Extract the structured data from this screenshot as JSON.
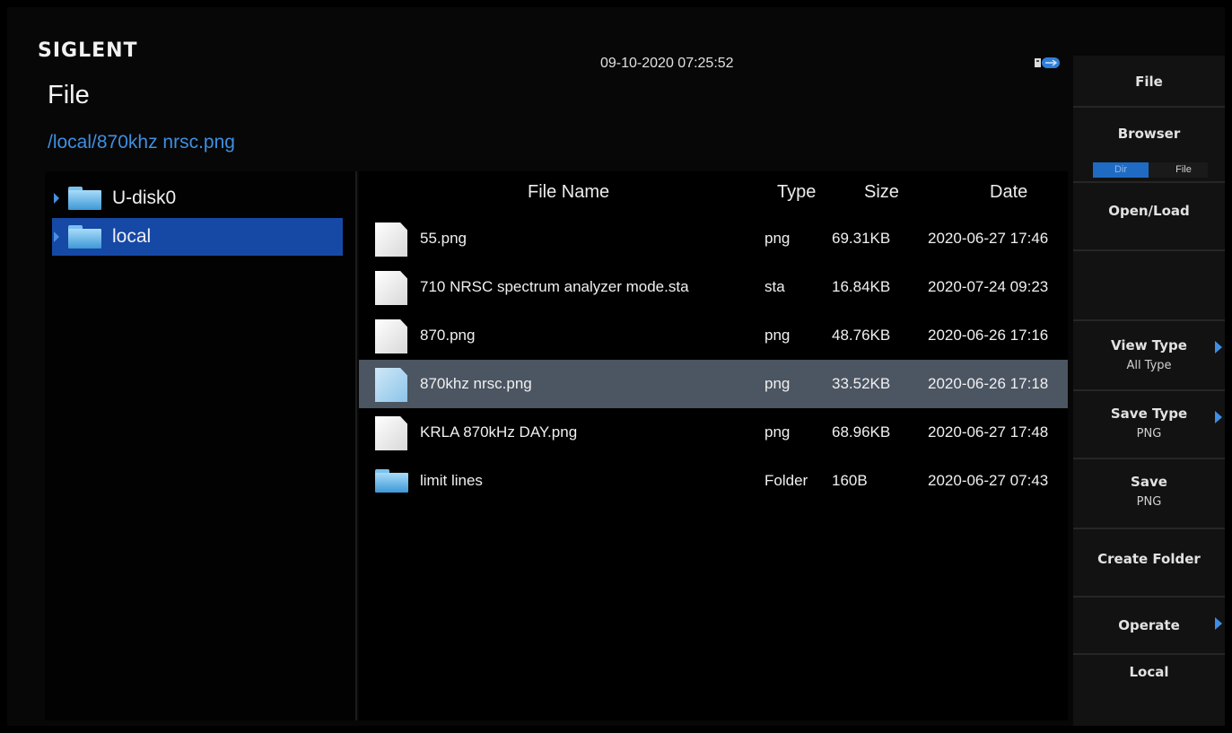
{
  "header": {
    "brand": "SIGLENT",
    "title": "File",
    "datetime": "09-10-2020 07:25:52",
    "usb_icon": "usb-storage-icon",
    "path": "/local/870khz nrsc.png"
  },
  "tree": {
    "items": [
      {
        "label": "U-disk0",
        "icon": "folder-icon",
        "selected": false
      },
      {
        "label": "local",
        "icon": "folder-icon",
        "selected": true
      }
    ]
  },
  "list": {
    "columns": {
      "name": "File Name",
      "type": "Type",
      "size": "Size",
      "date": "Date"
    },
    "rows": [
      {
        "name": "55.png",
        "type": "png",
        "size": "69.31KB",
        "date": "2020-06-27 17:46",
        "icon": "file-icon"
      },
      {
        "name": "710 NRSC spectrum analyzer mode.sta",
        "type": "sta",
        "size": "16.84KB",
        "date": "2020-07-24 09:23",
        "icon": "file-icon"
      },
      {
        "name": "870.png",
        "type": "png",
        "size": "48.76KB",
        "date": "2020-06-26 17:16",
        "icon": "file-icon"
      },
      {
        "name": "870khz nrsc.png",
        "type": "png",
        "size": "33.52KB",
        "date": "2020-06-26 17:18",
        "icon": "file-icon",
        "selected": true
      },
      {
        "name": "KRLA 870kHz DAY.png",
        "type": "png",
        "size": "68.96KB",
        "date": "2020-06-27 17:48",
        "icon": "file-icon"
      },
      {
        "name": "limit lines",
        "type": "Folder",
        "size": "160B",
        "date": "2020-06-27 07:43",
        "icon": "folder-icon"
      }
    ]
  },
  "menu": {
    "title": "File",
    "browser": {
      "label": "Browser",
      "option_dir": "Dir",
      "option_file": "File",
      "selected": "Dir"
    },
    "open_load": "Open/Load",
    "view_type": {
      "label": "View Type",
      "value": "All Type"
    },
    "save_type": {
      "label": "Save Type",
      "value": "PNG"
    },
    "save": {
      "label": "Save",
      "value": "PNG"
    },
    "create_folder": "Create Folder",
    "operate": "Operate",
    "local": "Local",
    "accent_color": "#1f6bc4"
  }
}
